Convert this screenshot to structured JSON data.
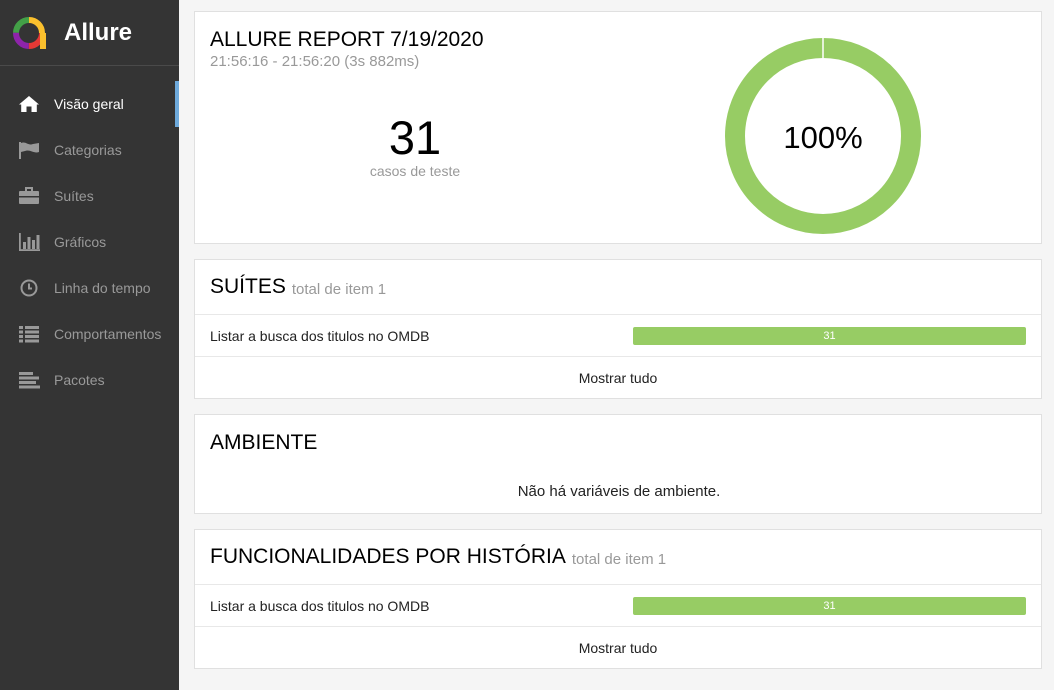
{
  "app": {
    "name": "Allure"
  },
  "nav": {
    "items": [
      {
        "label": "Visão geral",
        "icon": "home-icon"
      },
      {
        "label": "Categorias",
        "icon": "flag-icon"
      },
      {
        "label": "Suítes",
        "icon": "briefcase-icon"
      },
      {
        "label": "Gráficos",
        "icon": "bar-chart-icon"
      },
      {
        "label": "Linha do tempo",
        "icon": "clock-icon"
      },
      {
        "label": "Comportamentos",
        "icon": "list-icon"
      },
      {
        "label": "Pacotes",
        "icon": "align-left-icon"
      }
    ],
    "active_index": 0
  },
  "summary": {
    "title": "ALLURE REPORT 7/19/2020",
    "time_range": "21:56:16 - 21:56:20 (3s 882ms)",
    "test_count": "31",
    "test_count_label": "casos de teste",
    "pass_rate": "100%"
  },
  "chart_data": {
    "type": "pie",
    "categories": [
      "passed"
    ],
    "values": [
      31
    ]
  },
  "suites": {
    "title": "SUÍTES",
    "subtitle": "total de item 1",
    "rows": [
      {
        "label": "Listar a busca dos titulos no OMDB",
        "value": "31"
      }
    ],
    "show_all": "Mostrar tudo"
  },
  "environment": {
    "title": "AMBIENTE",
    "empty_message": "Não há variáveis de ambiente."
  },
  "features": {
    "title": "FUNCIONALIDADES POR HISTÓRIA",
    "subtitle": "total de item 1",
    "rows": [
      {
        "label": "Listar a busca dos titulos no OMDB",
        "value": "31"
      }
    ],
    "show_all": "Mostrar tudo"
  },
  "colors": {
    "sidebar_bg": "#343434",
    "active_indicator": "#6eaadc",
    "passed": "#97cc64"
  }
}
